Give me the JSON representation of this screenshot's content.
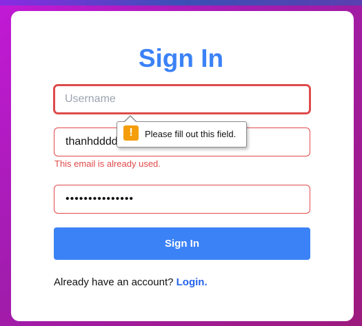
{
  "form": {
    "title": "Sign In",
    "username": {
      "placeholder": "Username",
      "value": ""
    },
    "email": {
      "value": "thanhdddd"
    },
    "email_error": "This email is already used.",
    "password": {
      "value": "•••••••••••••••"
    },
    "submit_label": "Sign In"
  },
  "footer": {
    "text": "Already have an account?",
    "link_label": "Login."
  },
  "tooltip": {
    "icon": "warning-icon",
    "icon_glyph": "!",
    "message": "Please fill out this field."
  },
  "colors": {
    "accent": "#3b82f6",
    "error": "#e04848",
    "warning": "#f59e0b"
  }
}
